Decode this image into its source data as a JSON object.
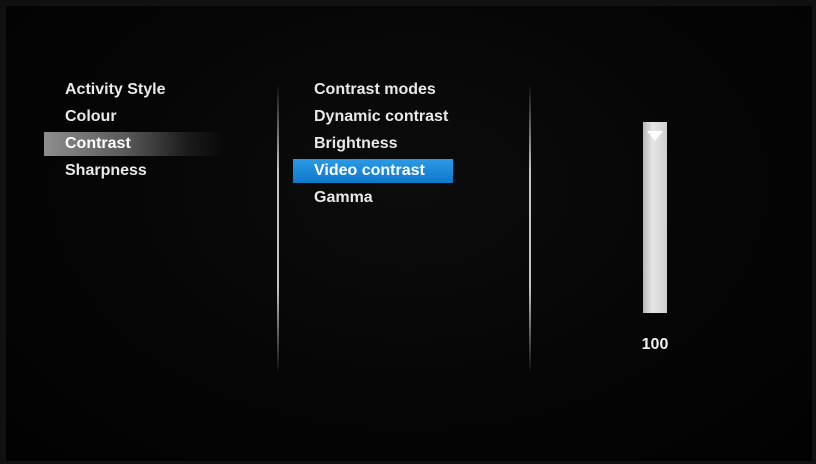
{
  "settings_menu": {
    "categories": [
      {
        "label": "Activity Style"
      },
      {
        "label": "Colour"
      },
      {
        "label": "Contrast"
      },
      {
        "label": "Sharpness"
      }
    ],
    "selected_category": "Contrast"
  },
  "contrast_submenu": {
    "items": [
      {
        "label": "Contrast modes"
      },
      {
        "label": "Dynamic contrast"
      },
      {
        "label": "Brightness"
      },
      {
        "label": "Video contrast"
      },
      {
        "label": "Gamma"
      }
    ],
    "focused_item": "Video contrast"
  },
  "video_contrast_slider": {
    "value": "100",
    "level_percent": 100,
    "orientation": "vertical"
  },
  "colors": {
    "focus_highlight": "#1a88d9",
    "parent_highlight": "#6e6e6e",
    "text": "#e9e9e9",
    "background": "#050505"
  },
  "icons": {
    "slider_thumb": "triangle-down-icon"
  }
}
